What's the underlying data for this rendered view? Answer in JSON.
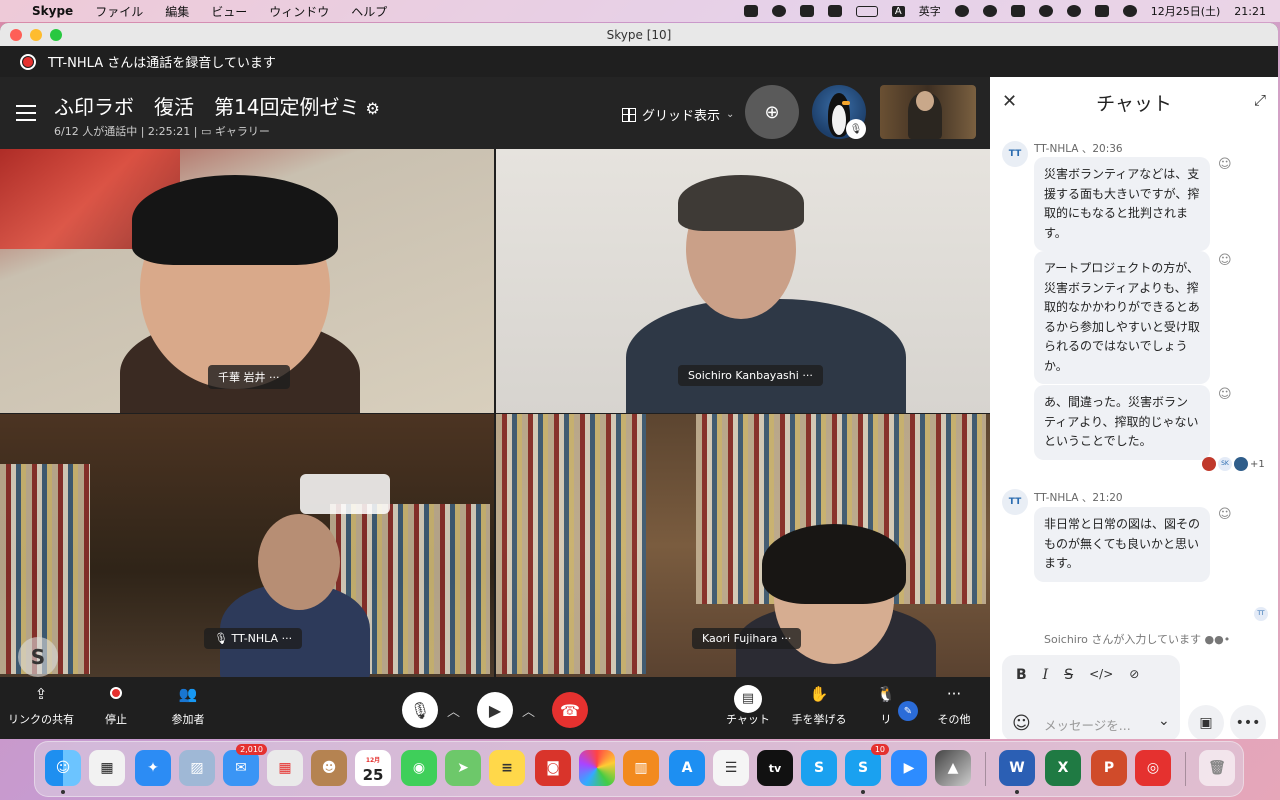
{
  "menubar": {
    "app_name": "Skype",
    "menus": [
      "ファイル",
      "編集",
      "ビュー",
      "ウィンドウ",
      "ヘルプ"
    ],
    "input_indicator": "A",
    "input_mode": "英字",
    "date": "12月25日(土)",
    "time": "21:21"
  },
  "window": {
    "title": "Skype [10]"
  },
  "recording": {
    "text": "TT-NHLA さんは通話を録音しています"
  },
  "call": {
    "title": "ふ印ラボ　復活　第14回定例ゼミ",
    "subtitle": "6/12 人が通話中 | 2:25:21 |",
    "view_mode": "ギャラリー",
    "grid_label": "グリッド表示"
  },
  "participants": [
    {
      "name": "千華 岩井"
    },
    {
      "name": "Soichiro Kanbayashi"
    },
    {
      "name": "TT-NHLA"
    },
    {
      "name": "Kaori Fujihara"
    }
  ],
  "more_glyph": "···",
  "s_badge": "S",
  "controls": {
    "share_link": "リンクの共有",
    "stop": "停止",
    "participants": "参加者",
    "chat": "チャット",
    "raise_hand": "手を挙げる",
    "react": "リ",
    "more": "その他"
  },
  "chat": {
    "title": "チャット",
    "avatar_initials": "TT",
    "messages": [
      {
        "meta": "TT-NHLA 、20:36",
        "text": "災害ボランティアなどは、支援する面も大きいですが、搾取的にもなると批判されます。"
      },
      {
        "text": "アートプロジェクトの方が、災害ボランティアよりも、搾取的なかかわりができるとあるから参加しやすいと受け取られるのではないでしょうか。"
      },
      {
        "text": "あ、間違った。災害ボランティアより、搾取的じゃないということでした。"
      },
      {
        "meta": "TT-NHLA 、21:20",
        "text": "非日常と日常の図は、図そのものが無くても良いかと思います。"
      }
    ],
    "seen_sk": "SK",
    "seen_count": "+1",
    "seen_tt": "TT",
    "typing": "Soichiro さんが入力しています",
    "input_placeholder": "メッセージを..."
  },
  "dock": {
    "mail_badge": "2,010",
    "calendar_month": "12月",
    "calendar_day": "25",
    "skype_badge": "10",
    "appletv": "tv"
  },
  "colors": {
    "record_red": "#e5312f",
    "chat_bubble": "#eff1f5",
    "call_bg": "#1f1f1f"
  }
}
